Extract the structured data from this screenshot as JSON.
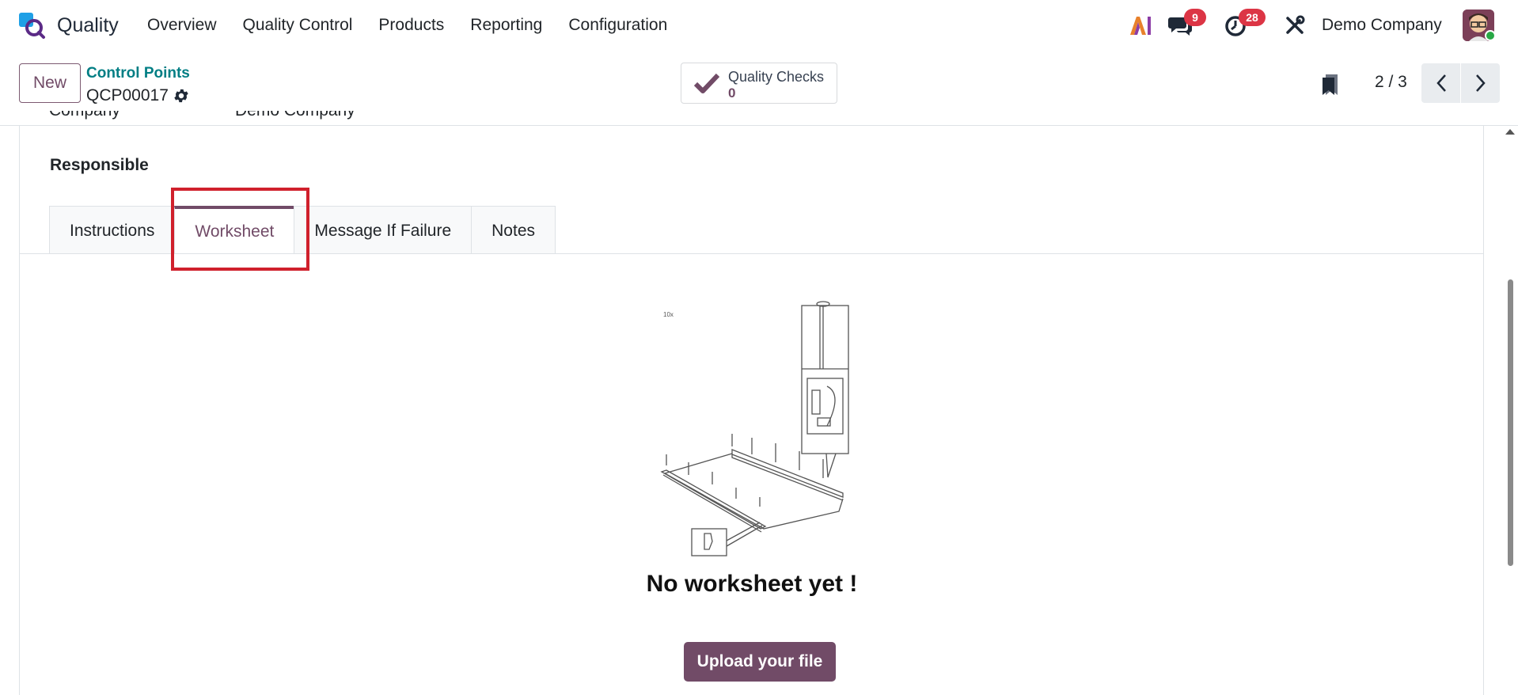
{
  "app": {
    "name": "Quality",
    "menu": [
      "Overview",
      "Quality Control",
      "Products",
      "Reporting",
      "Configuration"
    ],
    "chat_count": "9",
    "activity_count": "28",
    "company": "Demo Company"
  },
  "control": {
    "new_label": "New",
    "breadcrumb": "Control Points",
    "record": "QCP00017",
    "smart_label": "Quality Checks",
    "smart_value": "0",
    "pager": "2 / 3"
  },
  "form": {
    "cut_company_label": "Company",
    "cut_company_value": "Demo Company",
    "responsible_label": "Responsible",
    "tabs": [
      "Instructions",
      "Worksheet",
      "Message If Failure",
      "Notes"
    ],
    "active_tab": "Worksheet",
    "empty_title": "No worksheet yet !",
    "upload_label": "Upload your file"
  },
  "colors": {
    "accent": "#714b67",
    "link": "#017e84",
    "badge": "#dc3545",
    "highlight": "#d0202c"
  }
}
